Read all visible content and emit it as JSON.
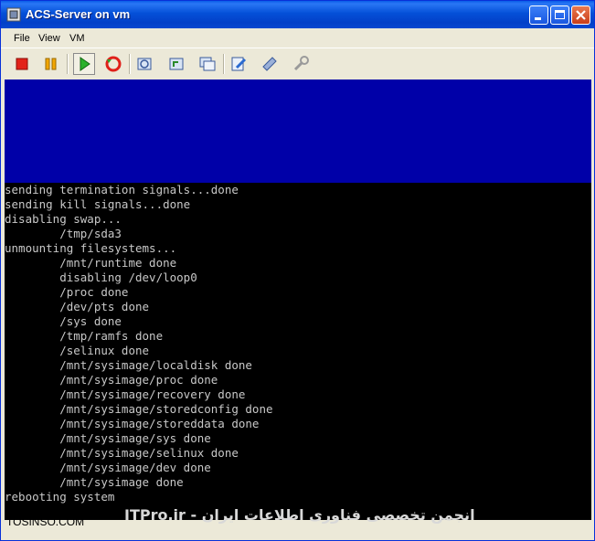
{
  "window": {
    "title": "ACS-Server on vm"
  },
  "menu": {
    "items": [
      "File",
      "View",
      "VM"
    ]
  },
  "toolbar": {
    "icons": [
      "stop-icon",
      "pause-icon",
      "play-icon",
      "reset-icon",
      "snapshot-icon",
      "revert-snapshot-icon",
      "snapshot-manager-icon",
      "edit-settings-icon",
      "vmware-tools-icon",
      "configure-icon"
    ]
  },
  "colors": {
    "console_bg": "#000000",
    "bios_band": "#0000a8",
    "console_text": "#c8c8c8"
  },
  "console": {
    "lines": [
      "sending termination signals...done",
      "sending kill signals...done",
      "disabling swap...",
      "        /tmp/sda3",
      "unmounting filesystems...",
      "        /mnt/runtime done",
      "        disabling /dev/loop0",
      "        /proc done",
      "        /dev/pts done",
      "        /sys done",
      "        /tmp/ramfs done",
      "        /selinux done",
      "        /mnt/sysimage/localdisk done",
      "        /mnt/sysimage/proc done",
      "        /mnt/sysimage/recovery done",
      "        /mnt/sysimage/storedconfig done",
      "        /mnt/sysimage/storeddata done",
      "        /mnt/sysimage/sys done",
      "        /mnt/sysimage/selinux done",
      "        /mnt/sysimage/dev done",
      "        /mnt/sysimage done",
      "rebooting system"
    ]
  },
  "watermark": {
    "text": "ITPro.ir - انجمن تخصصی فناوری اطلاعات ایران"
  },
  "footer": {
    "site": "TOSINSO.COM"
  }
}
